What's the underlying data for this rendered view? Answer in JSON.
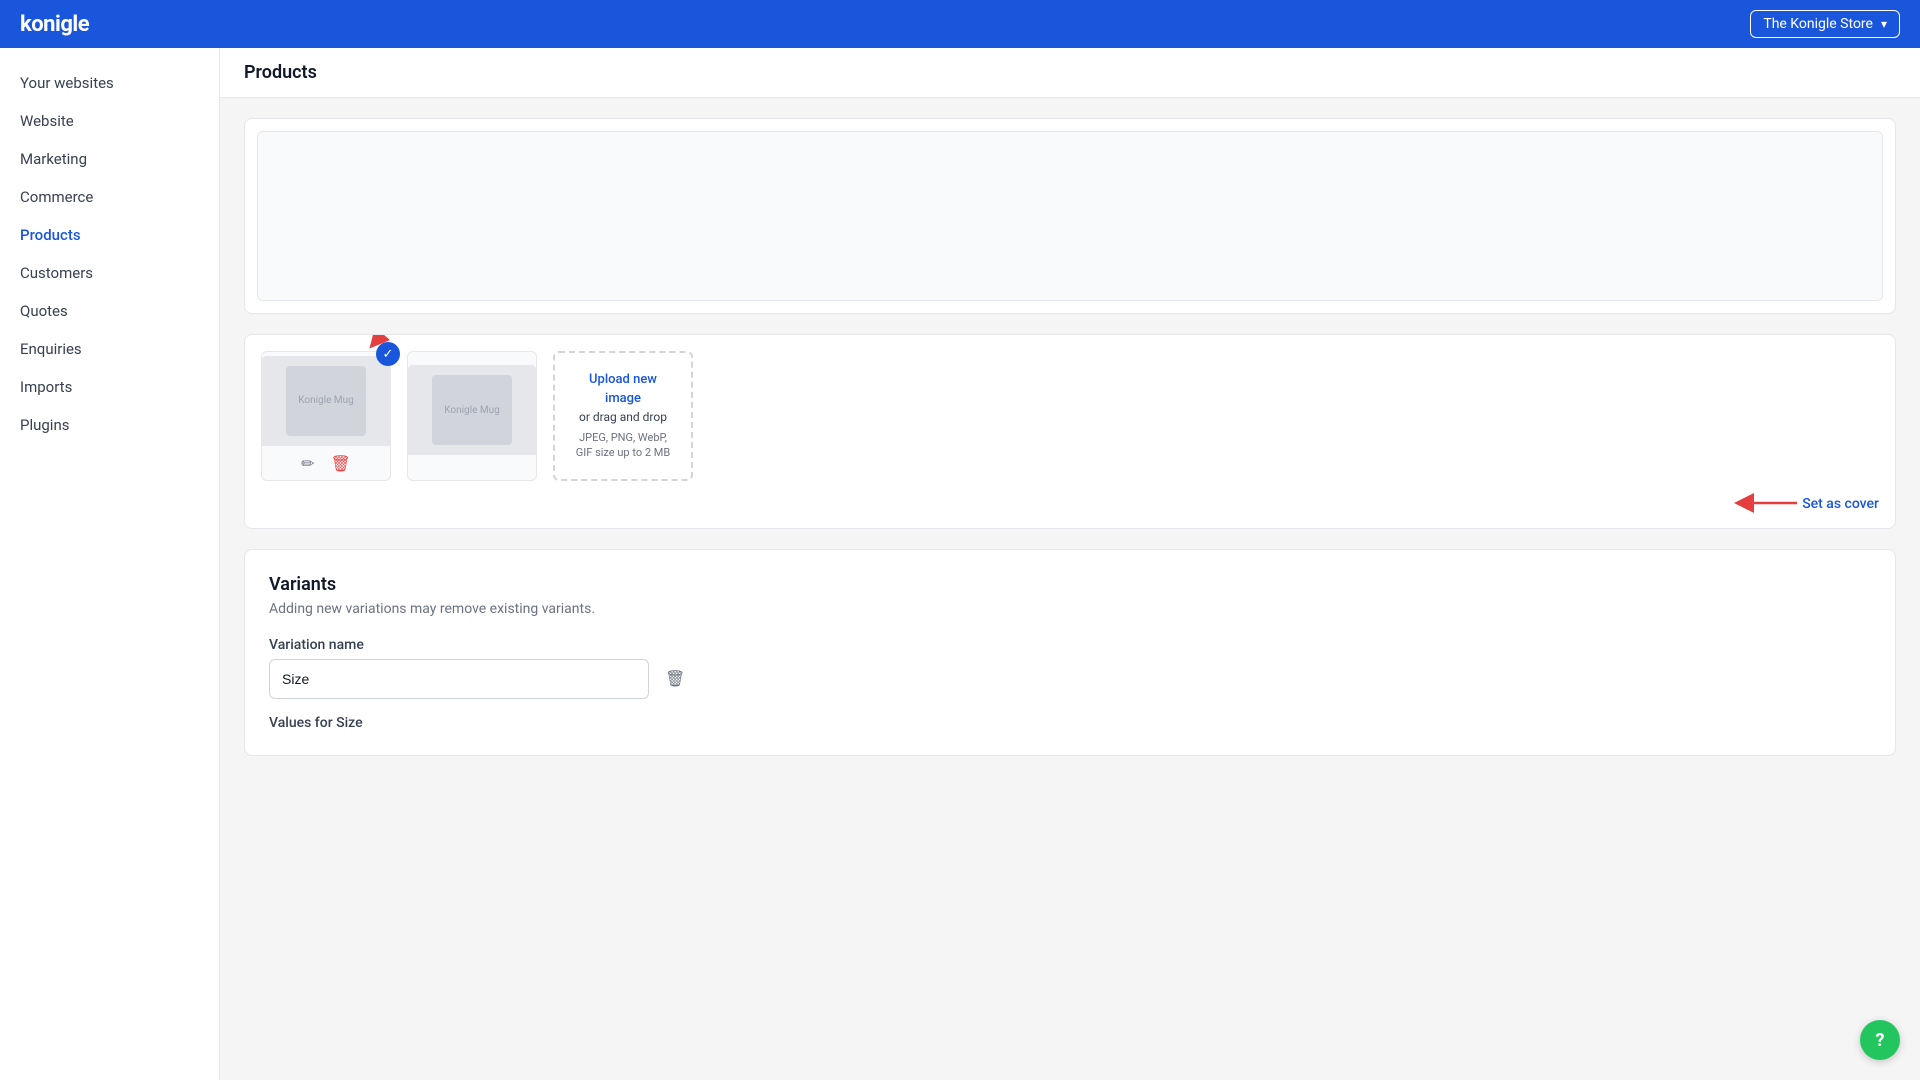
{
  "header": {
    "logo": "konigle",
    "store_name": "The Konigle Store",
    "chevron": "▾"
  },
  "sidebar": {
    "items": [
      {
        "id": "your-websites",
        "label": "Your websites",
        "active": false
      },
      {
        "id": "website",
        "label": "Website",
        "active": false
      },
      {
        "id": "marketing",
        "label": "Marketing",
        "active": false
      },
      {
        "id": "commerce",
        "label": "Commerce",
        "active": false,
        "section": true
      },
      {
        "id": "products",
        "label": "Products",
        "active": true
      },
      {
        "id": "customers",
        "label": "Customers",
        "active": false
      },
      {
        "id": "quotes",
        "label": "Quotes",
        "active": false
      },
      {
        "id": "enquiries",
        "label": "Enquiries",
        "active": false
      },
      {
        "id": "imports",
        "label": "Imports",
        "active": false
      },
      {
        "id": "plugins",
        "label": "Plugins",
        "active": false
      }
    ]
  },
  "page": {
    "title": "Products"
  },
  "gallery": {
    "image1_alt": "Konigle Mug",
    "image2_alt": "Konigle Mug",
    "upload_link": "Upload new\nimage",
    "upload_or": "or drag and drop",
    "upload_hint": "JPEG, PNG, WebP,\nGIF size up to 2 MB",
    "set_as_cover": "Set as cover",
    "edit_icon": "✏",
    "delete_icon": "🗑",
    "check_icon": "✓"
  },
  "variants": {
    "title": "Variants",
    "subtitle": "Adding new variations may remove existing variants.",
    "variation_name_label": "Variation name",
    "variation_name_value": "Size",
    "variation_name_placeholder": "Size",
    "values_label": "Values for Size",
    "delete_icon": "🗑"
  },
  "help": {
    "icon": "?"
  }
}
